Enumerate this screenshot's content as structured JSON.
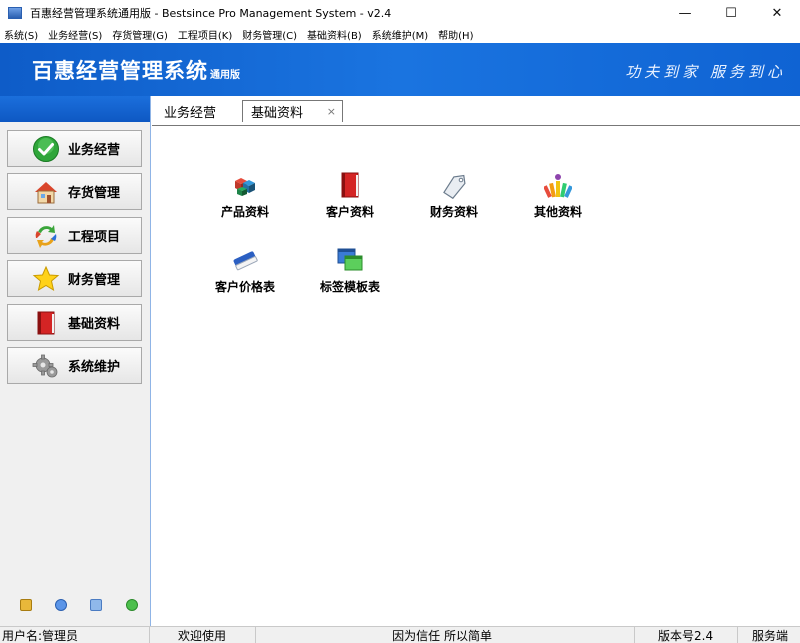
{
  "window": {
    "title": "百惠经营管理系统通用版 - Bestsince Pro Management System - v2.4",
    "controls": {
      "minimize": "—",
      "maximize": "☐",
      "close": "✕"
    }
  },
  "menu": [
    "系统(S)",
    "业务经营(S)",
    "存货管理(G)",
    "工程项目(K)",
    "财务管理(C)",
    "基础资料(B)",
    "系统维护(M)",
    "帮助(H)"
  ],
  "banner": {
    "title": "百惠经营管理系统",
    "edition": "通用版",
    "slogan": "功夫到家 服务到心"
  },
  "sidebar": {
    "items": [
      {
        "label": "业务经营",
        "icon": "check-icon"
      },
      {
        "label": "存货管理",
        "icon": "house-icon"
      },
      {
        "label": "工程项目",
        "icon": "recycle-arrows-icon"
      },
      {
        "label": "财务管理",
        "icon": "star-icon"
      },
      {
        "label": "基础资料",
        "icon": "red-book-icon"
      },
      {
        "label": "系统维护",
        "icon": "gear-icon"
      }
    ],
    "bottom_icons": [
      "folder-icon",
      "clock-icon",
      "search-icon",
      "refresh-icon"
    ]
  },
  "tabs": [
    {
      "label": "业务经营",
      "active": false
    },
    {
      "label": "基础资料",
      "active": true,
      "close": "×"
    }
  ],
  "tiles": [
    {
      "label": "产品资料",
      "icon": "cubes-icon"
    },
    {
      "label": "客户资料",
      "icon": "red-book-icon"
    },
    {
      "label": "财务资料",
      "icon": "price-tag-icon"
    },
    {
      "label": "其他资料",
      "icon": "color-swatch-icon"
    },
    {
      "label": "客户价格表",
      "icon": "eraser-icon"
    },
    {
      "label": "标签模板表",
      "icon": "windows-icon"
    }
  ],
  "status": {
    "user": "用户名:管理员",
    "welcome": "欢迎使用",
    "motto": "因为信任 所以简单",
    "version": "版本号2.4",
    "mode": "服务端"
  },
  "colors": {
    "banner": "#1569d8",
    "sidebar_bg": "#f0f0f0"
  }
}
